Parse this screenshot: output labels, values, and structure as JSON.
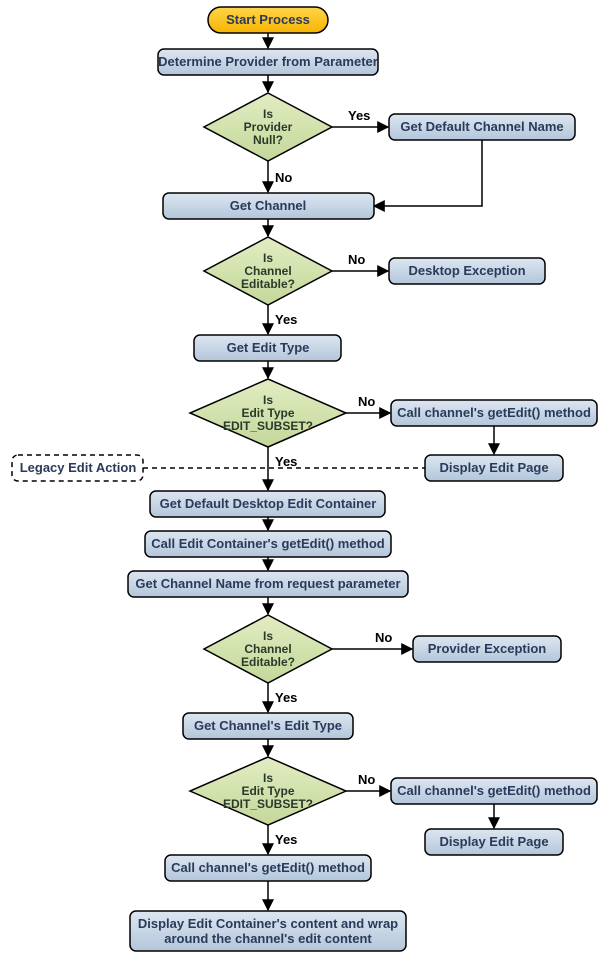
{
  "chart_data": {
    "type": "flowchart",
    "nodes": [
      {
        "id": "start",
        "label": "Start Process",
        "type": "terminator"
      },
      {
        "id": "determine",
        "label": "Determine Provider from Parameter",
        "type": "process"
      },
      {
        "id": "isProviderNull",
        "label_l1": "Is",
        "label_l2": "Provider",
        "label_l3": "Null?",
        "type": "decision"
      },
      {
        "id": "getDefaultName",
        "label": "Get Default Channel Name",
        "type": "process"
      },
      {
        "id": "getChannel",
        "label": "Get Channel",
        "type": "process"
      },
      {
        "id": "isEditable1",
        "label_l1": "Is",
        "label_l2": "Channel",
        "label_l3": "Editable?",
        "type": "decision"
      },
      {
        "id": "desktopException",
        "label": "Desktop Exception",
        "type": "process"
      },
      {
        "id": "getEditType",
        "label": "Get Edit Type",
        "type": "process"
      },
      {
        "id": "isSubset1",
        "label_l1": "Is",
        "label_l2": "Edit Type",
        "label_l3": "EDIT_SUBSET?",
        "type": "decision"
      },
      {
        "id": "callGetEdit1",
        "label": "Call channel's getEdit() method",
        "type": "process"
      },
      {
        "id": "displayEditPage1",
        "label": "Display Edit Page",
        "type": "process"
      },
      {
        "id": "legacy",
        "label": "Legacy Edit Action",
        "type": "note"
      },
      {
        "id": "getDefaultContainer",
        "label": "Get Default Desktop Edit Container",
        "type": "process"
      },
      {
        "id": "callContainerGetEdit",
        "label": "Call Edit Container's getEdit() method",
        "type": "process"
      },
      {
        "id": "getChannelNameReq",
        "label": "Get Channel Name from request parameter",
        "type": "process"
      },
      {
        "id": "isEditable2",
        "label_l1": "Is",
        "label_l2": "Channel",
        "label_l3": "Editable?",
        "type": "decision"
      },
      {
        "id": "providerException",
        "label": "Provider Exception",
        "type": "process"
      },
      {
        "id": "getChannelEditType",
        "label": "Get Channel's Edit Type",
        "type": "process"
      },
      {
        "id": "isSubset2",
        "label_l1": "Is",
        "label_l2": "Edit Type",
        "label_l3": "EDIT_SUBSET?",
        "type": "decision"
      },
      {
        "id": "callGetEdit2",
        "label": "Call channel's getEdit() method",
        "type": "process"
      },
      {
        "id": "displayEditPage2",
        "label": "Display Edit Page",
        "type": "process"
      },
      {
        "id": "callGetEdit3",
        "label": "Call channel's getEdit() method",
        "type": "process"
      },
      {
        "id": "displayWrap",
        "label_l1": "Display Edit Container's content and wrap",
        "label_l2": "around the channel's edit content",
        "type": "process"
      }
    ],
    "edges": [
      {
        "from": "start",
        "to": "determine"
      },
      {
        "from": "determine",
        "to": "isProviderNull"
      },
      {
        "from": "isProviderNull",
        "to": "getDefaultName",
        "label": "Yes"
      },
      {
        "from": "isProviderNull",
        "to": "getChannel",
        "label": "No"
      },
      {
        "from": "getDefaultName",
        "to": "getChannel"
      },
      {
        "from": "getChannel",
        "to": "isEditable1"
      },
      {
        "from": "isEditable1",
        "to": "desktopException",
        "label": "No"
      },
      {
        "from": "isEditable1",
        "to": "getEditType",
        "label": "Yes"
      },
      {
        "from": "getEditType",
        "to": "isSubset1"
      },
      {
        "from": "isSubset1",
        "to": "callGetEdit1",
        "label": "No"
      },
      {
        "from": "callGetEdit1",
        "to": "displayEditPage1"
      },
      {
        "from": "isSubset1",
        "to": "getDefaultContainer",
        "label": "Yes"
      },
      {
        "from": "getDefaultContainer",
        "to": "callContainerGetEdit"
      },
      {
        "from": "callContainerGetEdit",
        "to": "getChannelNameReq"
      },
      {
        "from": "getChannelNameReq",
        "to": "isEditable2"
      },
      {
        "from": "isEditable2",
        "to": "providerException",
        "label": "No"
      },
      {
        "from": "isEditable2",
        "to": "getChannelEditType",
        "label": "Yes"
      },
      {
        "from": "getChannelEditType",
        "to": "isSubset2"
      },
      {
        "from": "isSubset2",
        "to": "callGetEdit2",
        "label": "No"
      },
      {
        "from": "callGetEdit2",
        "to": "displayEditPage2"
      },
      {
        "from": "isSubset2",
        "to": "callGetEdit3",
        "label": "Yes"
      },
      {
        "from": "callGetEdit3",
        "to": "displayWrap"
      }
    ]
  },
  "labels": {
    "yes": "Yes",
    "no": "No"
  }
}
